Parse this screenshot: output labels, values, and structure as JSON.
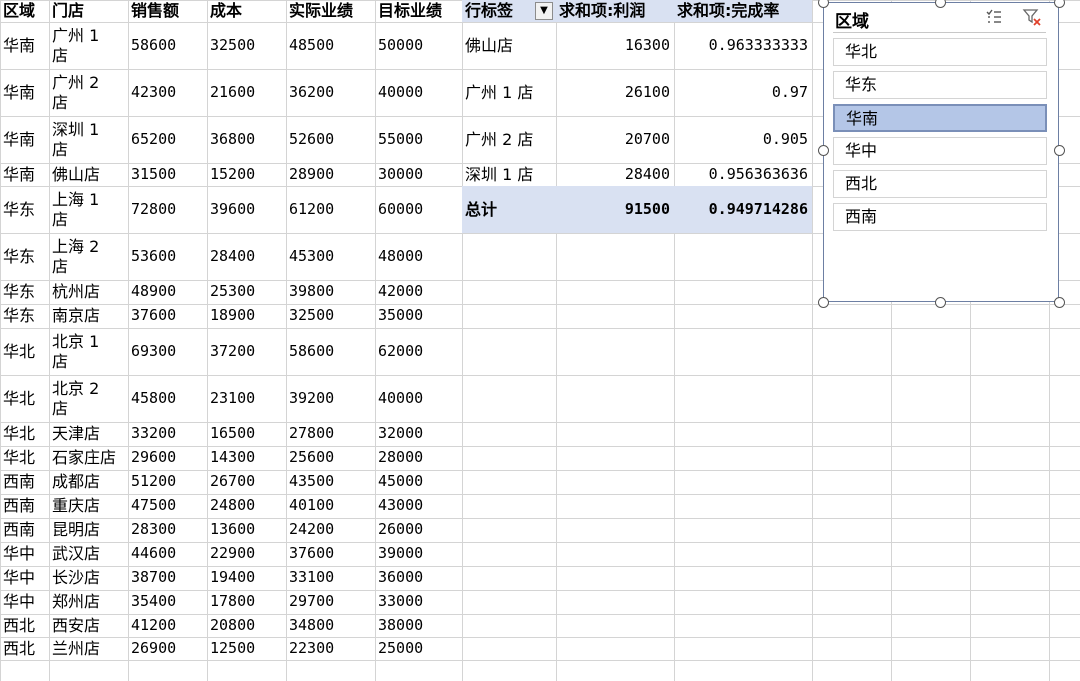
{
  "source": {
    "headers": [
      "区域",
      "门店",
      "销售额",
      "成本",
      "实际业绩",
      "目标业绩"
    ],
    "rows": [
      {
        "region": "华南",
        "store": "广州 1\n店",
        "sales": "58600",
        "cost": "32500",
        "actual": "48500",
        "target": "50000"
      },
      {
        "region": "华南",
        "store": "广州 2\n店",
        "sales": "42300",
        "cost": "21600",
        "actual": "36200",
        "target": "40000"
      },
      {
        "region": "华南",
        "store": "深圳 1\n店",
        "sales": "65200",
        "cost": "36800",
        "actual": "52600",
        "target": "55000"
      },
      {
        "region": "华南",
        "store": "佛山店",
        "sales": "31500",
        "cost": "15200",
        "actual": "28900",
        "target": "30000"
      },
      {
        "region": "华东",
        "store": "上海 1\n店",
        "sales": "72800",
        "cost": "39600",
        "actual": "61200",
        "target": "60000"
      },
      {
        "region": "华东",
        "store": "上海 2\n店",
        "sales": "53600",
        "cost": "28400",
        "actual": "45300",
        "target": "48000"
      },
      {
        "region": "华东",
        "store": "杭州店",
        "sales": "48900",
        "cost": "25300",
        "actual": "39800",
        "target": "42000"
      },
      {
        "region": "华东",
        "store": "南京店",
        "sales": "37600",
        "cost": "18900",
        "actual": "32500",
        "target": "35000"
      },
      {
        "region": "华北",
        "store": "北京 1\n店",
        "sales": "69300",
        "cost": "37200",
        "actual": "58600",
        "target": "62000"
      },
      {
        "region": "华北",
        "store": "北京 2\n店",
        "sales": "45800",
        "cost": "23100",
        "actual": "39200",
        "target": "40000"
      },
      {
        "region": "华北",
        "store": "天津店",
        "sales": "33200",
        "cost": "16500",
        "actual": "27800",
        "target": "32000"
      },
      {
        "region": "华北",
        "store": "石家庄店",
        "sales": "29600",
        "cost": "14300",
        "actual": "25600",
        "target": "28000"
      },
      {
        "region": "西南",
        "store": "成都店",
        "sales": "51200",
        "cost": "26700",
        "actual": "43500",
        "target": "45000"
      },
      {
        "region": "西南",
        "store": "重庆店",
        "sales": "47500",
        "cost": "24800",
        "actual": "40100",
        "target": "43000"
      },
      {
        "region": "西南",
        "store": "昆明店",
        "sales": "28300",
        "cost": "13600",
        "actual": "24200",
        "target": "26000"
      },
      {
        "region": "华中",
        "store": "武汉店",
        "sales": "44600",
        "cost": "22900",
        "actual": "37600",
        "target": "39000"
      },
      {
        "region": "华中",
        "store": "长沙店",
        "sales": "38700",
        "cost": "19400",
        "actual": "33100",
        "target": "36000"
      },
      {
        "region": "华中",
        "store": "郑州店",
        "sales": "35400",
        "cost": "17800",
        "actual": "29700",
        "target": "33000"
      },
      {
        "region": "西北",
        "store": "西安店",
        "sales": "41200",
        "cost": "20800",
        "actual": "34800",
        "target": "38000"
      },
      {
        "region": "西北",
        "store": "兰州店",
        "sales": "26900",
        "cost": "12500",
        "actual": "22300",
        "target": "25000"
      }
    ]
  },
  "pivot": {
    "headers": [
      "行标签",
      "求和项:利润",
      "求和项:完成率"
    ],
    "rows": [
      {
        "label": "佛山店",
        "profit": "16300",
        "rate": "0.963333333"
      },
      {
        "label": "广州 1 店",
        "profit": "26100",
        "rate": "0.97"
      },
      {
        "label": "广州 2 店",
        "profit": "20700",
        "rate": "0.905"
      },
      {
        "label": "深圳 1 店",
        "profit": "28400",
        "rate": "0.956363636"
      }
    ],
    "total": {
      "label": "总计",
      "profit": "91500",
      "rate": "0.949714286"
    },
    "dropdown_icon": "dropdown-arrow-icon"
  },
  "slicer": {
    "title": "区域",
    "items": [
      "华北",
      "华东",
      "华南",
      "华中",
      "西北",
      "西南"
    ],
    "selected": "华南",
    "icons": [
      "multi-select-icon",
      "clear-filter-icon"
    ]
  },
  "colors": {
    "grid": "#d4d4d4",
    "pivot_highlight": "#d9e1f2",
    "slicer_selected": "#b4c6e7",
    "clear_filter": "#e0402b"
  }
}
